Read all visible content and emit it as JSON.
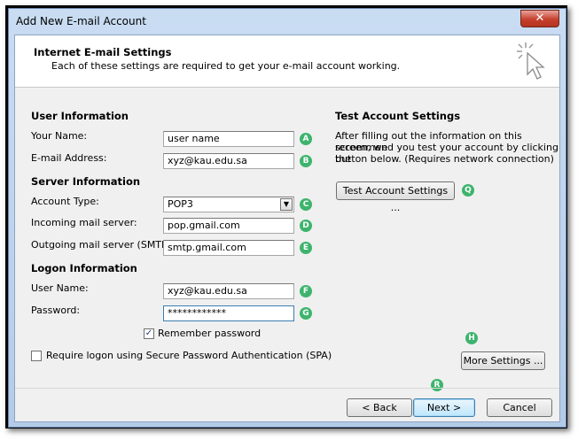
{
  "window": {
    "title": "Add New E-mail Account",
    "close_glyph": "✕"
  },
  "header": {
    "title": "Internet E-mail Settings",
    "subtitle": "Each of these settings are required to get your e-mail account working.",
    "icon": "cursor-click-icon"
  },
  "user_info": {
    "section_title": "User Information",
    "name_label": "Your Name:",
    "name_value": "user name",
    "email_label": "E-mail Address:",
    "email_value": "xyz@kau.edu.sa"
  },
  "server_info": {
    "section_title": "Server Information",
    "account_type_label": "Account Type:",
    "account_type_value": "POP3",
    "incoming_label": "Incoming mail server:",
    "incoming_value": "pop.gmail.com",
    "outgoing_label": "Outgoing mail server (SMTP):",
    "outgoing_value": "smtp.gmail.com"
  },
  "logon_info": {
    "section_title": "Logon Information",
    "username_label": "User Name:",
    "username_value": "xyz@kau.edu.sa",
    "password_label": "Password:",
    "password_value": "************",
    "remember_label": "Remember password",
    "remember_checked": true,
    "spa_label": "Require logon using Secure Password Authentication (SPA)",
    "spa_checked": false
  },
  "test": {
    "section_title": "Test Account Settings",
    "description_line1": "After filling out the information on this screen, we",
    "description_line2": "recommend you test your account by clicking the",
    "description_line3": "button below. (Requires network connection)",
    "button_label": "Test Account Settings ..."
  },
  "more_settings_label": "More Settings ...",
  "footer": {
    "back_label": "< Back",
    "next_label": "Next >",
    "cancel_label": "Cancel"
  },
  "badges": {
    "a": "A",
    "b": "B",
    "c": "C",
    "d": "D",
    "e": "E",
    "f": "F",
    "g": "G",
    "h": "H",
    "q": "Q",
    "r": "R"
  },
  "colors": {
    "badge": "#3db46d",
    "title_bar": "#c9dcf2",
    "close_button": "#c6402d"
  }
}
